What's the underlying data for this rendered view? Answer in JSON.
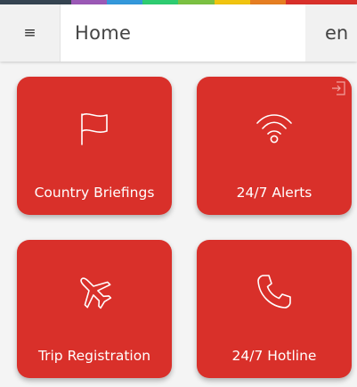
{
  "header": {
    "title": "Home",
    "language": "en",
    "menu_icon": "hamburger-icon",
    "menu_glyph": "≡"
  },
  "stripe_colors": [
    "#354451",
    "#354451",
    "#9b59b6",
    "#3498db",
    "#2ecc71",
    "#7bc142",
    "#f1c40f",
    "#e67e22",
    "#d9302a",
    "#d9302a"
  ],
  "tiles": [
    {
      "label": "Country Briefings",
      "icon": "flag-icon"
    },
    {
      "label": "24/7 Alerts",
      "icon": "wifi-signal-icon"
    },
    {
      "label": "Trip Registration",
      "icon": "airplane-icon"
    },
    {
      "label": "24/7 Hotline",
      "icon": "phone-icon"
    }
  ],
  "colors": {
    "tile": "#d9302a",
    "background": "#f4f4f4",
    "header": "#f1f1f1"
  }
}
